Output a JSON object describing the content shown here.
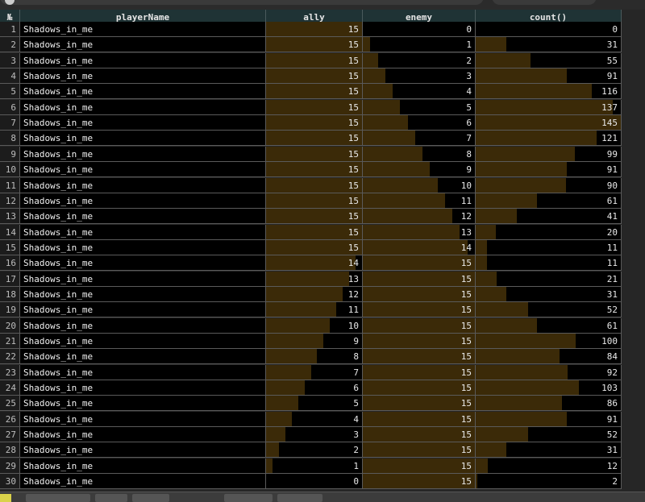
{
  "table": {
    "corner_label": "№",
    "columns": [
      "playerName",
      "ally",
      "enemy",
      "count()"
    ],
    "max_value": 15,
    "count_max": 145,
    "first_row_index": 1,
    "rows": [
      [
        "Shadows_in_me",
        15,
        0,
        0
      ],
      [
        "Shadows_in_me",
        15,
        1,
        31
      ],
      [
        "Shadows_in_me",
        15,
        2,
        55
      ],
      [
        "Shadows_in_me",
        15,
        3,
        91
      ],
      [
        "Shadows_in_me",
        15,
        4,
        116
      ],
      [
        "Shadows_in_me",
        15,
        5,
        137
      ],
      [
        "Shadows_in_me",
        15,
        6,
        145
      ],
      [
        "Shadows_in_me",
        15,
        7,
        121
      ],
      [
        "Shadows_in_me",
        15,
        8,
        99
      ],
      [
        "Shadows_in_me",
        15,
        9,
        91
      ],
      [
        "Shadows_in_me",
        15,
        10,
        90
      ],
      [
        "Shadows_in_me",
        15,
        11,
        61
      ],
      [
        "Shadows_in_me",
        15,
        12,
        41
      ],
      [
        "Shadows_in_me",
        15,
        13,
        20
      ],
      [
        "Shadows_in_me",
        15,
        14,
        11
      ],
      [
        "Shadows_in_me",
        14,
        15,
        11
      ],
      [
        "Shadows_in_me",
        13,
        15,
        21
      ],
      [
        "Shadows_in_me",
        12,
        15,
        31
      ],
      [
        "Shadows_in_me",
        11,
        15,
        52
      ],
      [
        "Shadows_in_me",
        10,
        15,
        61
      ],
      [
        "Shadows_in_me",
        9,
        15,
        100
      ],
      [
        "Shadows_in_me",
        8,
        15,
        84
      ],
      [
        "Shadows_in_me",
        7,
        15,
        92
      ],
      [
        "Shadows_in_me",
        6,
        15,
        103
      ],
      [
        "Shadows_in_me",
        5,
        15,
        86
      ],
      [
        "Shadows_in_me",
        4,
        15,
        91
      ],
      [
        "Shadows_in_me",
        3,
        15,
        52
      ],
      [
        "Shadows_in_me",
        2,
        15,
        31
      ],
      [
        "Shadows_in_me",
        1,
        15,
        12
      ],
      [
        "Shadows_in_me",
        0,
        15,
        2
      ]
    ]
  },
  "colors": {
    "bar_fill": "#3b2a08",
    "header_bg": "#1f3335",
    "cell_bg": "#000000"
  }
}
